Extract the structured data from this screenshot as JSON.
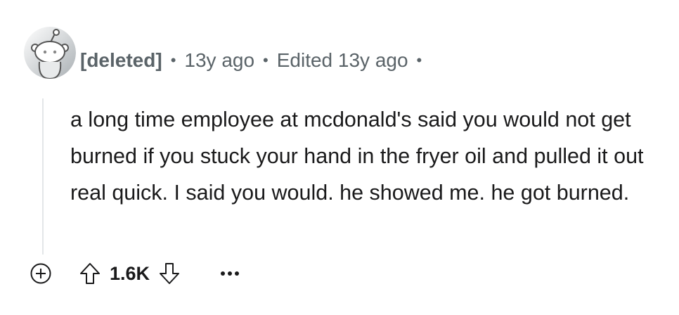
{
  "comment": {
    "author": "[deleted]",
    "posted_age": "13y ago",
    "edited": "Edited 13y ago",
    "separator": "•",
    "body": "a long time employee at mcdonald's said you would not get burned if you stuck your hand in the fryer oil and pulled it out real quick. I said you would. he showed me. he got burned.",
    "score": "1.6K",
    "icons": {
      "avatar": "snoo-avatar-icon",
      "expand": "plus-circle-icon",
      "upvote": "arrow-up-icon",
      "downvote": "arrow-down-icon",
      "more": "ellipsis-icon"
    }
  },
  "colors": {
    "meta_text": "#5a6368",
    "body_text": "#1a1a1b",
    "thread_line": "#e3e6e8"
  }
}
